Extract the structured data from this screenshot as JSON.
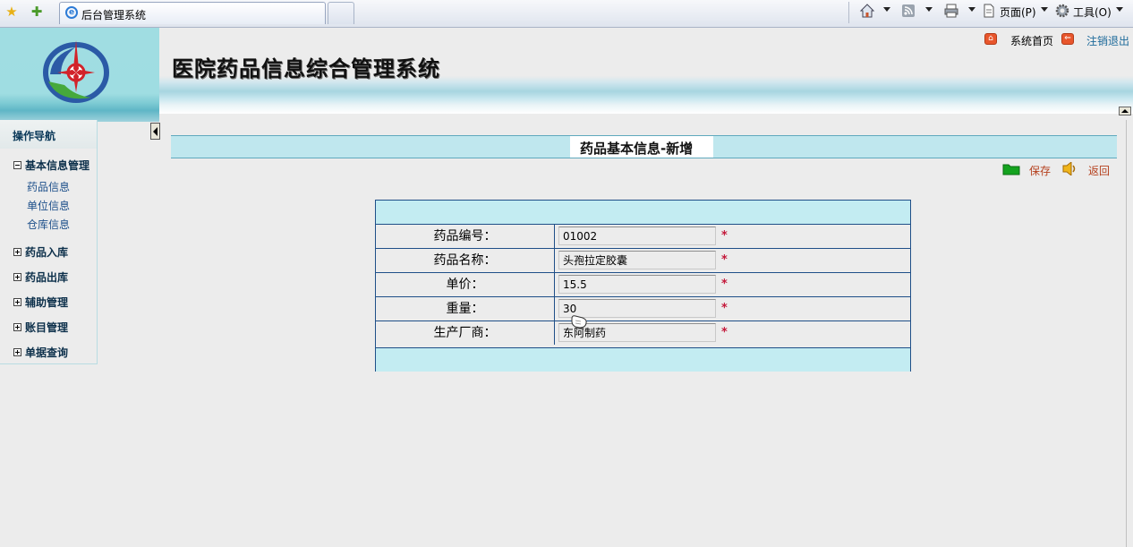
{
  "browser": {
    "tab_title": "后台管理系统",
    "menu_page": "页面(P)",
    "menu_tools": "工具(O)"
  },
  "header": {
    "system_title": "医院药品信息综合管理系统",
    "link_home": "系统首页",
    "link_logout": "注销退出"
  },
  "sidebar": {
    "title": "操作导航",
    "groups": [
      {
        "label": "基本信息管理",
        "expanded": true,
        "items": [
          "药品信息",
          "单位信息",
          "仓库信息"
        ]
      },
      {
        "label": "药品入库"
      },
      {
        "label": "药品出库"
      },
      {
        "label": "辅助管理"
      },
      {
        "label": "账目管理"
      },
      {
        "label": "单据查询"
      }
    ]
  },
  "main": {
    "page_title": "药品基本信息-新增",
    "save_label": "保存",
    "back_label": "返回"
  },
  "form": {
    "fields": [
      {
        "label": "药品编号：",
        "value": "01002",
        "required_mark": "*"
      },
      {
        "label": "药品名称：",
        "value": "头孢拉定胶囊",
        "required_mark": "*"
      },
      {
        "label": "单价：",
        "value": "15.5",
        "required_mark": "*"
      },
      {
        "label": "重量：",
        "value": "30",
        "required_mark": "*"
      },
      {
        "label": "生产厂商：",
        "value": "东阿制药",
        "required_mark": "*"
      }
    ]
  },
  "colors": {
    "accent_cyan": "#bfe7ee",
    "table_border": "#1f4f88",
    "link_blue": "#1d4f8a",
    "action_orange": "#b5401d",
    "required_red": "#c4183a"
  },
  "icons": [
    "favorites-star-icon",
    "add-favorite-icon",
    "ie-icon",
    "home-icon",
    "rss-icon",
    "print-icon",
    "page-icon",
    "gear-icon",
    "folder-save-icon",
    "back-speaker-icon",
    "logo-emblem"
  ]
}
